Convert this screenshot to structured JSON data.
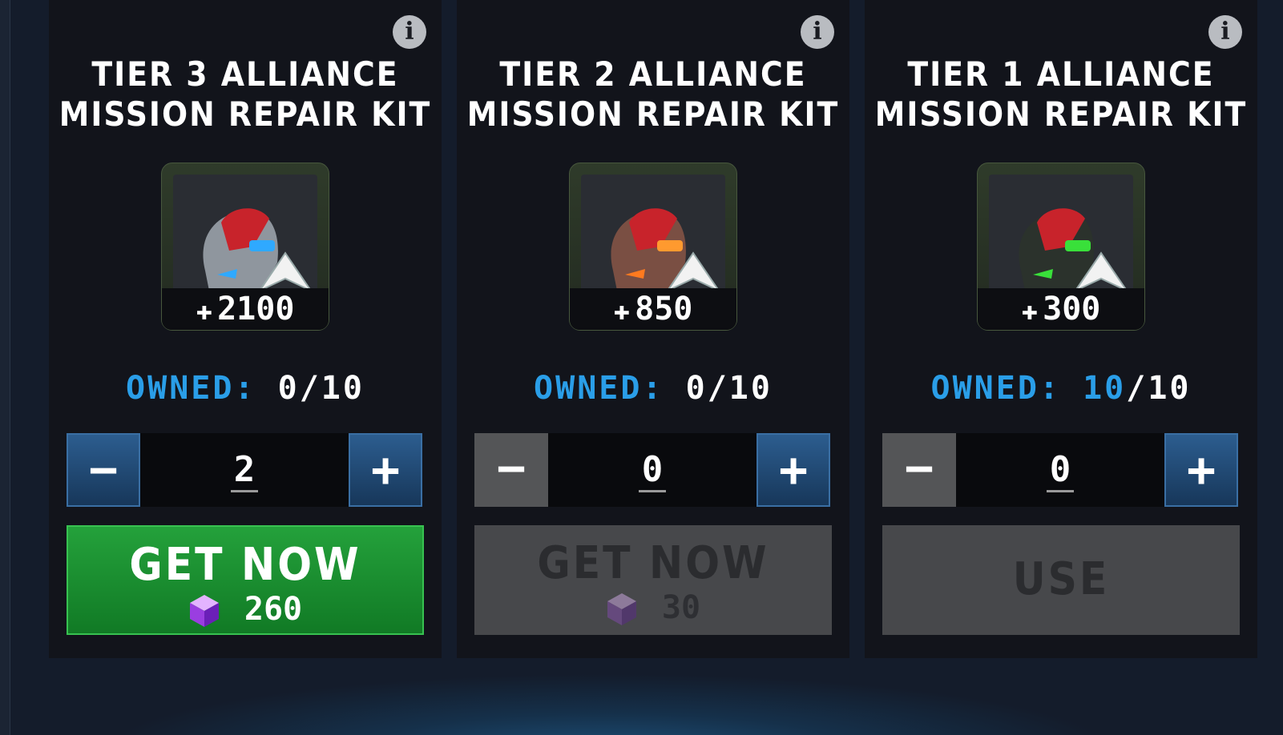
{
  "cards": [
    {
      "title_line1": "TIER 3 ALLIANCE",
      "title_line2": "MISSION REPAIR KIT",
      "hp": "2100",
      "owned_label": "OWNED:",
      "owned_current": "0",
      "owned_max": "/10",
      "quantity": "2",
      "action_label": "GET NOW",
      "action_price": "260",
      "accent_color": "#2fa9ff",
      "state": "enabled"
    },
    {
      "title_line1": "TIER 2 ALLIANCE",
      "title_line2": "MISSION REPAIR KIT",
      "hp": "850",
      "owned_label": "OWNED:",
      "owned_current": "0",
      "owned_max": "/10",
      "quantity": "0",
      "action_label": "GET NOW",
      "action_price": "30",
      "accent_color": "#ff9a2f",
      "state": "disabled"
    },
    {
      "title_line1": "TIER 1 ALLIANCE",
      "title_line2": "MISSION REPAIR KIT",
      "hp": "300",
      "owned_label": "OWNED:",
      "owned_current": "10",
      "owned_max": "/10",
      "quantity": "0",
      "action_label": "USE",
      "accent_color": "#39e03a",
      "state": "disabled"
    }
  ],
  "icons": {
    "info": "i",
    "minus": "−",
    "plus": "+",
    "heart": "✚"
  }
}
